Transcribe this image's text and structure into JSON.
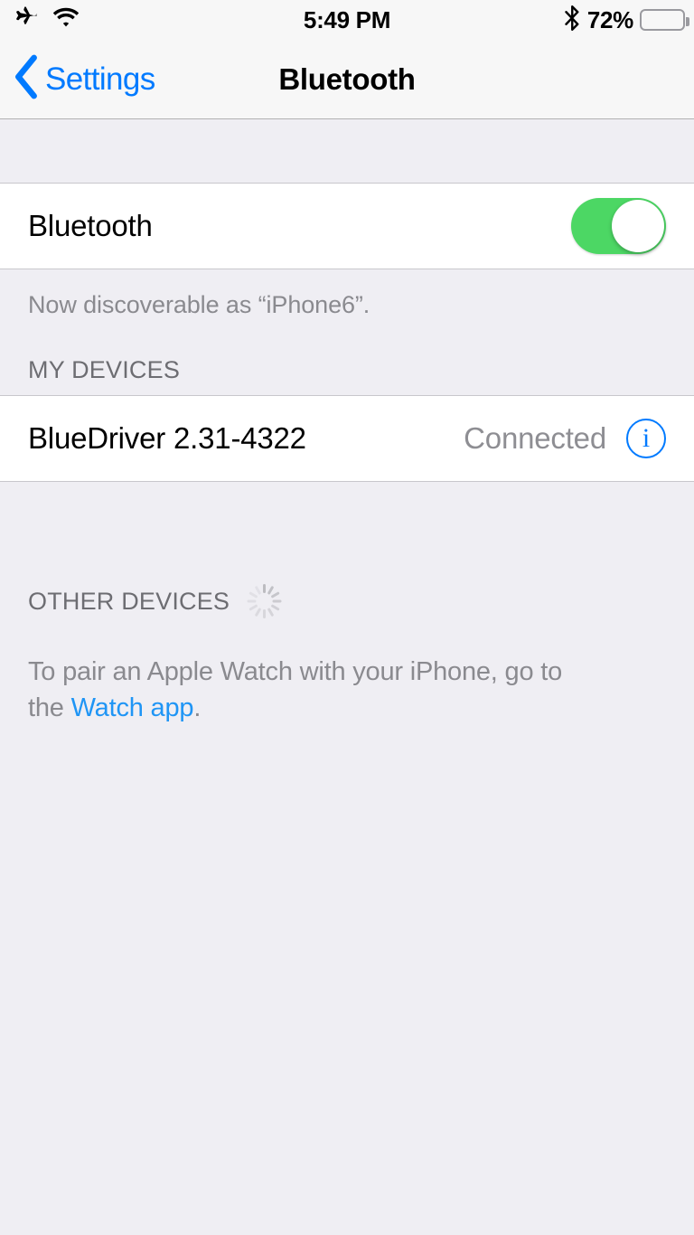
{
  "status_bar": {
    "airplane_icon": "airplane-icon",
    "wifi_icon": "wifi-icon",
    "time": "5:49 PM",
    "bluetooth_icon": "bluetooth-icon",
    "battery_percent": "72%",
    "battery_level": 72
  },
  "nav": {
    "back_icon": "chevron-left-icon",
    "back_label": "Settings",
    "title": "Bluetooth"
  },
  "bluetooth_row": {
    "label": "Bluetooth",
    "toggle_state": "on",
    "toggle_color": "#4CD764"
  },
  "discoverable_note": "Now discoverable as “iPhone6”.",
  "my_devices": {
    "header": "MY DEVICES",
    "devices": [
      {
        "name": "BlueDriver 2.31-4322",
        "status": "Connected",
        "info_icon": "info-circle-icon"
      }
    ]
  },
  "other_devices": {
    "header": "OTHER DEVICES",
    "spinner_icon": "activity-spinner-icon"
  },
  "pair_note": {
    "text_before": "To pair an Apple Watch with your iPhone, go to the ",
    "link_label": "Watch app",
    "text_after": "."
  },
  "colors": {
    "accent_blue": "#007AFF",
    "link_blue": "#1F95F5",
    "toggle_green": "#4CD764",
    "background_gray": "#EFEEF3",
    "cell_white": "#FFFFFF",
    "secondary_text": "#8E8E93"
  }
}
